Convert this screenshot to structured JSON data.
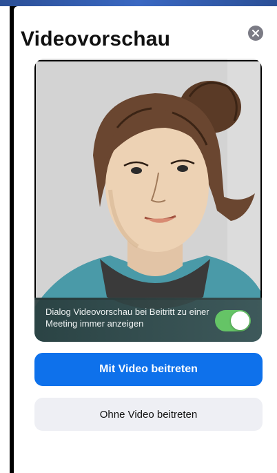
{
  "dialog": {
    "title": "Videovorschau",
    "close_icon": "close-icon"
  },
  "preview": {
    "toggle_label": "Dialog Videovorschau bei Beitritt zu einer Meeting immer anzeigen",
    "toggle_on": true,
    "toggle_color": "#65c466"
  },
  "actions": {
    "join_with_video": "Mit Video beitreten",
    "join_without_video": "Ohne Video beitreten",
    "primary_color": "#0e71eb"
  }
}
